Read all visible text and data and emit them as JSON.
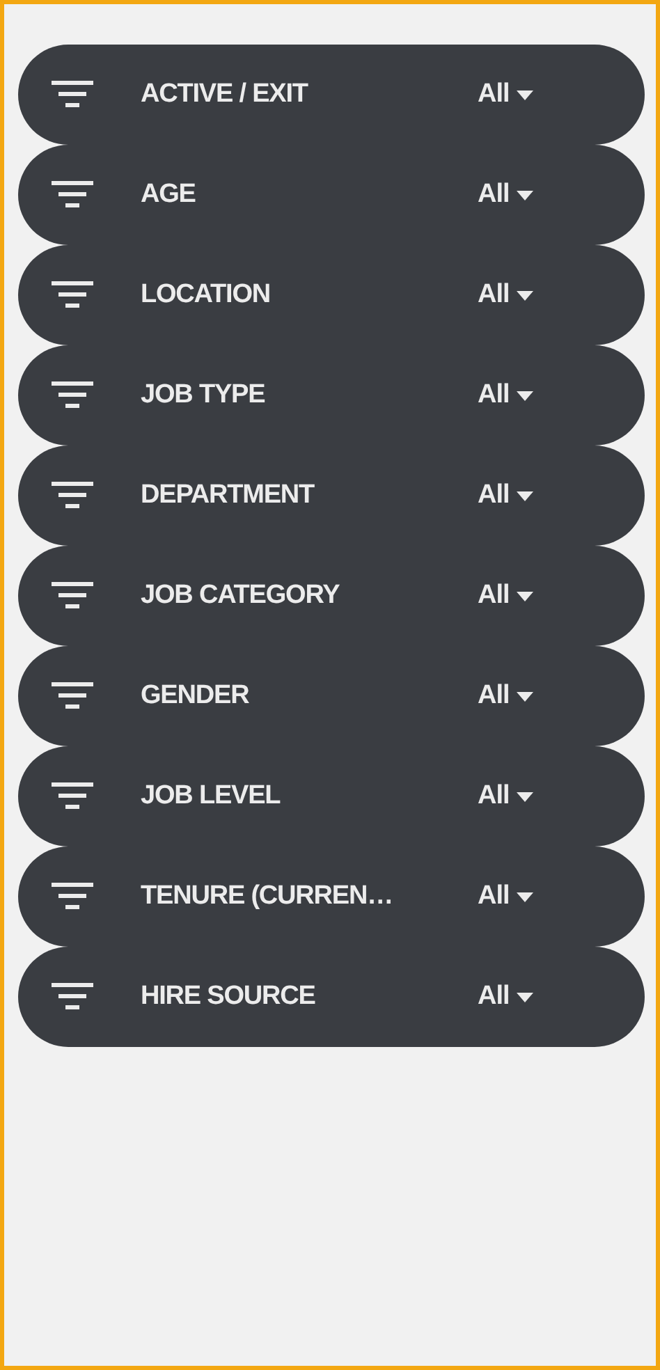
{
  "filters": [
    {
      "label": "ACTIVE / EXIT",
      "value": "All"
    },
    {
      "label": "AGE",
      "value": "All"
    },
    {
      "label": "LOCATION",
      "value": "All"
    },
    {
      "label": "JOB TYPE",
      "value": "All"
    },
    {
      "label": "DEPARTMENT",
      "value": "All"
    },
    {
      "label": "JOB CATEGORY",
      "value": "All"
    },
    {
      "label": "GENDER",
      "value": "All"
    },
    {
      "label": "JOB LEVEL",
      "value": "All"
    },
    {
      "label": "TENURE (CURREN…",
      "value": "All"
    },
    {
      "label": "HIRE SOURCE",
      "value": "All"
    }
  ]
}
